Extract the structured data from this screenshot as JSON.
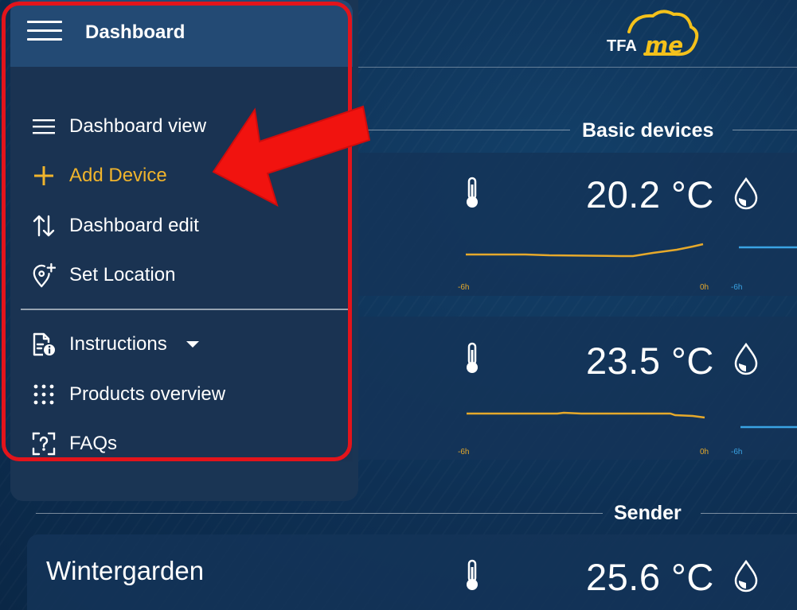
{
  "header": {
    "menu_title": "Dashboard",
    "logo": {
      "text_tfa": "TFA",
      "text_me": "me"
    }
  },
  "sidebar": {
    "items": [
      {
        "label": "Dashboard view",
        "icon": "list-icon"
      },
      {
        "label": "Add Device",
        "icon": "plus-icon",
        "active": true
      },
      {
        "label": "Dashboard edit",
        "icon": "sort-arrows-icon"
      },
      {
        "label": "Set Location",
        "icon": "add-location-icon"
      },
      {
        "label": "Instructions",
        "icon": "document-info-icon",
        "has_dropdown": true
      },
      {
        "label": "Products overview",
        "icon": "grid-dots-icon"
      },
      {
        "label": "FAQs",
        "icon": "question-frame-icon"
      }
    ]
  },
  "sections": [
    {
      "title": "Basic devices"
    },
    {
      "title": "Sender"
    }
  ],
  "devices": [
    {
      "temperature": "20.2 °C",
      "tick_start": "-6h",
      "tick_end": "0h",
      "tick_next": "-6h"
    },
    {
      "temperature": "23.5 °C",
      "tick_start": "-6h",
      "tick_end": "0h",
      "tick_next": "-6h"
    },
    {
      "name": "Wintergarden",
      "temperature": "25.6 °C"
    }
  ],
  "colors": {
    "background": "#0f3356",
    "menu_panel": "#1a3352",
    "menu_header": "#234a74",
    "accent": "#f0b42c",
    "highlight": "#e3141b",
    "chart_temp": "#e6a92b",
    "chart_humidity": "#3aa3e3"
  }
}
